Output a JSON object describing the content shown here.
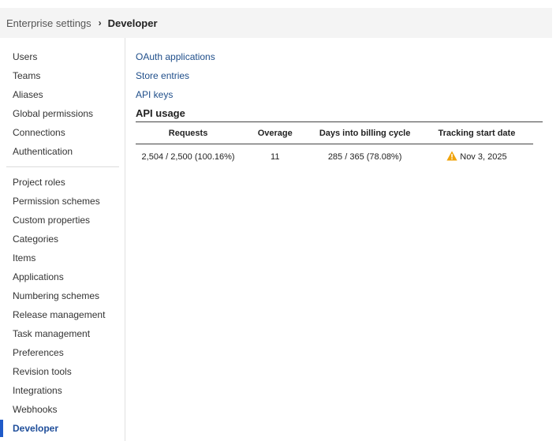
{
  "breadcrumb": {
    "parent": "Enterprise settings",
    "separator": "›",
    "current": "Developer"
  },
  "sidebar": {
    "group1": [
      {
        "label": "Users"
      },
      {
        "label": "Teams"
      },
      {
        "label": "Aliases"
      },
      {
        "label": "Global permissions"
      },
      {
        "label": "Connections"
      },
      {
        "label": "Authentication"
      }
    ],
    "group2": [
      {
        "label": "Project roles"
      },
      {
        "label": "Permission schemes"
      },
      {
        "label": "Custom properties"
      },
      {
        "label": "Categories"
      },
      {
        "label": "Items"
      },
      {
        "label": "Applications"
      },
      {
        "label": "Numbering schemes"
      },
      {
        "label": "Release management"
      },
      {
        "label": "Task management"
      },
      {
        "label": "Preferences"
      },
      {
        "label": "Revision tools"
      },
      {
        "label": "Integrations"
      },
      {
        "label": "Webhooks"
      },
      {
        "label": "Developer",
        "active": true
      }
    ]
  },
  "main": {
    "links": {
      "oauth": "OAuth applications",
      "store": "Store entries",
      "api_keys": "API keys"
    },
    "api_usage": {
      "title": "API usage",
      "columns": [
        "Requests",
        "Overage",
        "Days into billing cycle",
        "Tracking start date"
      ],
      "row": {
        "requests": "2,504 / 2,500 (100.16%)",
        "overage": "11",
        "days": "285 / 365 (78.08%)",
        "start_date": "Nov 3, 2025",
        "warning_icon": "warning-triangle-icon"
      }
    }
  },
  "colors": {
    "accent": "#1f5ac8",
    "link": "#1f4e8a",
    "warning": "#f0a30a"
  }
}
